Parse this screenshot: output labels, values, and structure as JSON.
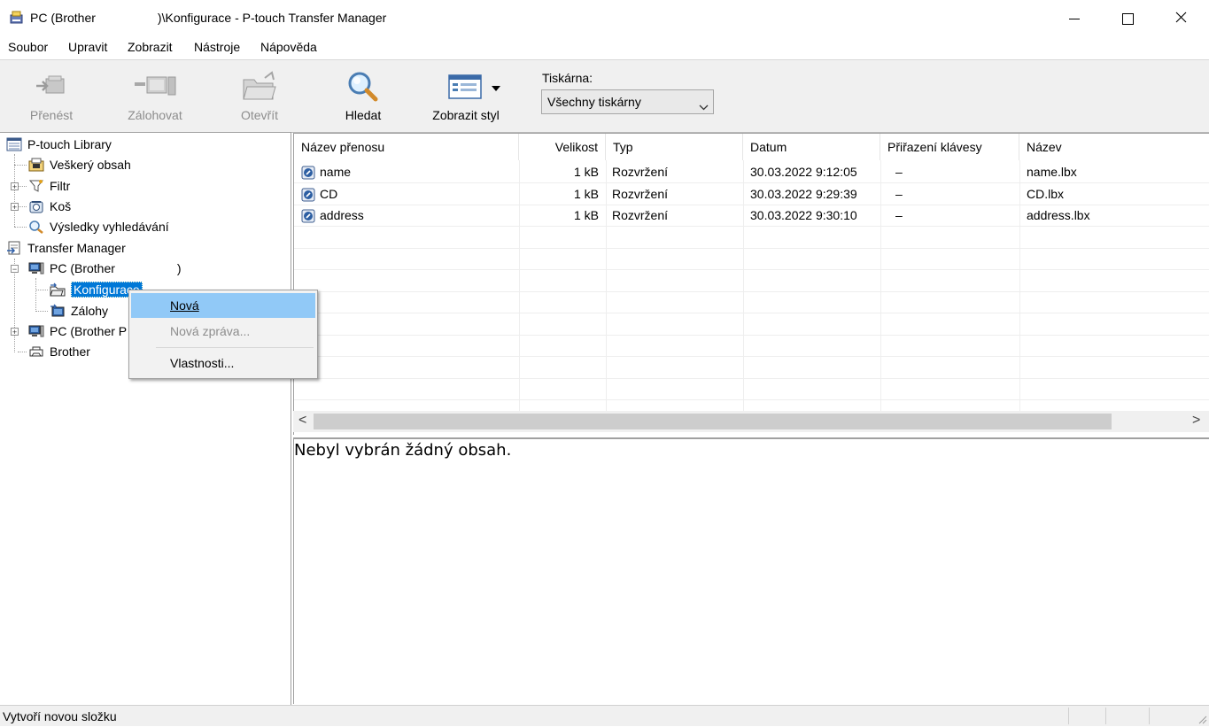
{
  "window": {
    "title": "PC (Brother                  )\\Konfigurace - P-touch Transfer Manager",
    "minimize_glyph": "—",
    "maximize_glyph": "☐",
    "close_glyph": "✕"
  },
  "menubar": {
    "items": [
      "Soubor",
      "Upravit",
      "Zobrazit",
      "Nástroje",
      "Nápověda"
    ]
  },
  "toolbar": {
    "buttons": [
      {
        "label": "Přenést",
        "icon": "transfer-icon",
        "enabled": false
      },
      {
        "label": "Zálohovat",
        "icon": "backup-icon",
        "enabled": false
      },
      {
        "label": "Otevřít",
        "icon": "open-folder-icon",
        "enabled": false
      },
      {
        "label": "Hledat",
        "icon": "magnifier-icon",
        "enabled": true
      },
      {
        "label": "Zobrazit styl",
        "icon": "view-style-icon",
        "enabled": true
      }
    ],
    "printer_label": "Tiskárna:",
    "printer_value": "Všechny tiskárny"
  },
  "tree": {
    "library_root": "P-touch Library",
    "all_content": "Veškerý obsah",
    "filter": "Filtr",
    "trash": "Koš",
    "search_results": "Výsledky vyhledávání",
    "transfer_root": "Transfer Manager",
    "pc1": "PC (Brother                  )",
    "configurations": "Konfigurace",
    "backups": "Zálohy",
    "pc2": "PC (Brother P",
    "brother": "Brother"
  },
  "list": {
    "columns": [
      "Název přenosu",
      "Velikost",
      "Typ",
      "Datum",
      "Přiřazení klávesy",
      "Název"
    ],
    "rows": [
      {
        "name": "name",
        "size": "1 kB",
        "type": "Rozvržení",
        "date": "30.03.2022 9:12:05",
        "key": "–",
        "file": "name.lbx"
      },
      {
        "name": "CD",
        "size": "1 kB",
        "type": "Rozvržení",
        "date": "30.03.2022 9:29:39",
        "key": "–",
        "file": "CD.lbx"
      },
      {
        "name": "address",
        "size": "1 kB",
        "type": "Rozvržení",
        "date": "30.03.2022 9:30:10",
        "key": "–",
        "file": "address.lbx"
      }
    ],
    "scroll_left": "<",
    "scroll_right": ">"
  },
  "preview": {
    "message": "Nebyl vybrán žádný obsah."
  },
  "status": {
    "text": "Vytvoří novou složku"
  },
  "context_menu": {
    "items": [
      {
        "label": "Nová",
        "enabled": true,
        "highlighted": true
      },
      {
        "label": "Nová zpráva...",
        "enabled": false
      },
      {
        "label": "Vlastnosti...",
        "enabled": true
      }
    ]
  },
  "colors": {
    "selection": "#0078d7",
    "menu_highlight": "#91c9f7",
    "disabled_text": "#8d8d8d"
  }
}
